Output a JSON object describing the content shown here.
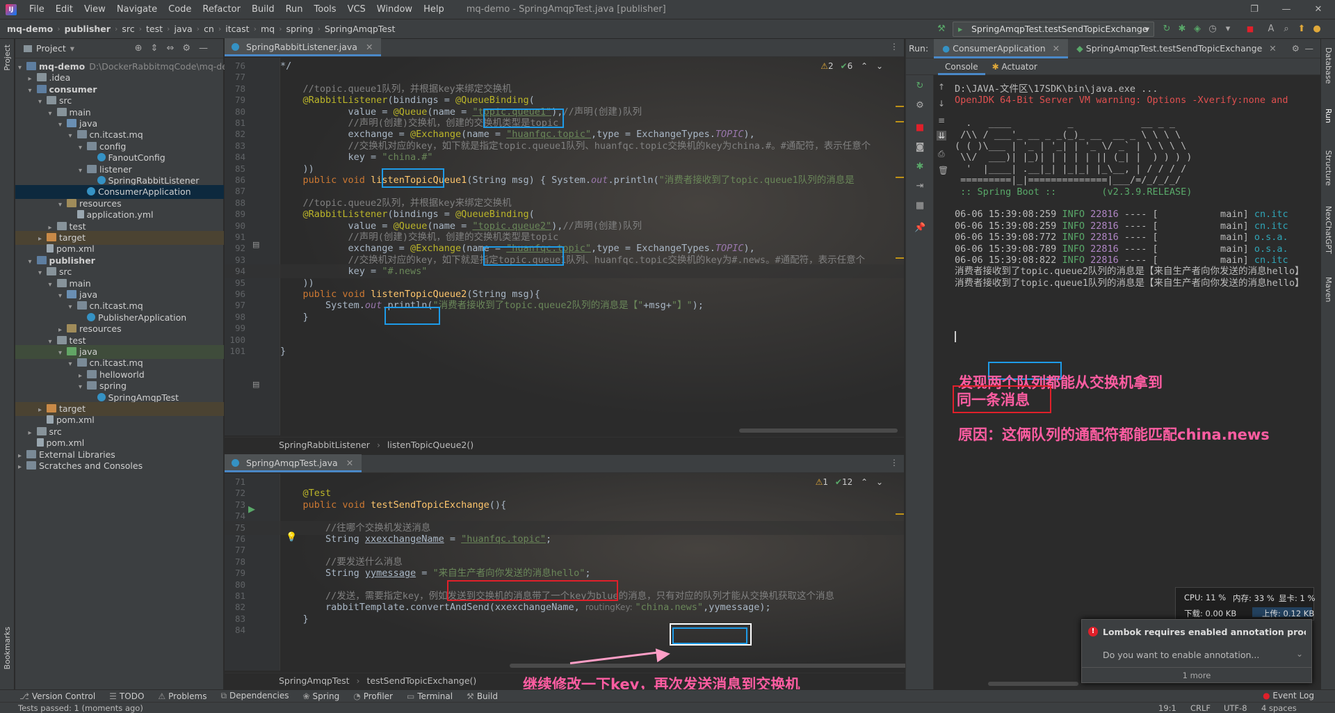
{
  "menubar": {
    "items": [
      "File",
      "Edit",
      "View",
      "Navigate",
      "Code",
      "Refactor",
      "Build",
      "Run",
      "Tools",
      "VCS",
      "Window",
      "Help"
    ],
    "window_title": "mq-demo - SpringAmqpTest.java [publisher]"
  },
  "navbar": {
    "crumbs": [
      "mq-demo",
      "publisher",
      "src",
      "test",
      "java",
      "cn",
      "itcast",
      "mq",
      "spring",
      "SpringAmqpTest"
    ],
    "run_config": "SpringAmqpTest.testSendTopicExchange"
  },
  "left_strip": {
    "project_label": "Project",
    "bookmarks_label": "Bookmarks"
  },
  "right_strip": {
    "labels": [
      "Database",
      "Run",
      "Structure",
      "NexChatGPT",
      "Maven"
    ]
  },
  "project": {
    "title": "Project",
    "tree": [
      {
        "label": "mq-demo",
        "path": "D:\\DockerRabbitmqCode\\mq-de",
        "depth": 0,
        "arrow": "▾",
        "icon": "module",
        "bold": true
      },
      {
        "label": ".idea",
        "depth": 1,
        "arrow": "▸",
        "icon": "folder"
      },
      {
        "label": "consumer",
        "depth": 1,
        "arrow": "▾",
        "icon": "module",
        "bold": true
      },
      {
        "label": "src",
        "depth": 2,
        "arrow": "▾",
        "icon": "folder"
      },
      {
        "label": "main",
        "depth": 3,
        "arrow": "▾",
        "icon": "folder"
      },
      {
        "label": "java",
        "depth": 4,
        "arrow": "▾",
        "icon": "folder-src"
      },
      {
        "label": "cn.itcast.mq",
        "depth": 5,
        "arrow": "▾",
        "icon": "pkg"
      },
      {
        "label": "config",
        "depth": 6,
        "arrow": "▾",
        "icon": "pkg"
      },
      {
        "label": "FanoutConfig",
        "depth": 7,
        "arrow": "",
        "icon": "cls"
      },
      {
        "label": "listener",
        "depth": 6,
        "arrow": "▾",
        "icon": "pkg"
      },
      {
        "label": "SpringRabbitListener",
        "depth": 7,
        "arrow": "",
        "icon": "cls"
      },
      {
        "label": "ConsumerApplication",
        "depth": 6,
        "arrow": "",
        "icon": "cls",
        "selected": true
      },
      {
        "label": "resources",
        "depth": 4,
        "arrow": "▾",
        "icon": "folder-res"
      },
      {
        "label": "application.yml",
        "depth": 5,
        "arrow": "",
        "icon": "file"
      },
      {
        "label": "test",
        "depth": 3,
        "arrow": "▸",
        "icon": "folder"
      },
      {
        "label": "target",
        "depth": 2,
        "arrow": "▸",
        "icon": "folder-target",
        "excluded": true
      },
      {
        "label": "pom.xml",
        "depth": 2,
        "arrow": "",
        "icon": "file"
      },
      {
        "label": "publisher",
        "depth": 1,
        "arrow": "▾",
        "icon": "module",
        "bold": true
      },
      {
        "label": "src",
        "depth": 2,
        "arrow": "▾",
        "icon": "folder"
      },
      {
        "label": "main",
        "depth": 3,
        "arrow": "▾",
        "icon": "folder"
      },
      {
        "label": "java",
        "depth": 4,
        "arrow": "▾",
        "icon": "folder-src"
      },
      {
        "label": "cn.itcast.mq",
        "depth": 5,
        "arrow": "▾",
        "icon": "pkg"
      },
      {
        "label": "PublisherApplication",
        "depth": 6,
        "arrow": "",
        "icon": "cls"
      },
      {
        "label": "resources",
        "depth": 4,
        "arrow": "▸",
        "icon": "folder-res"
      },
      {
        "label": "test",
        "depth": 3,
        "arrow": "▾",
        "icon": "folder"
      },
      {
        "label": "java",
        "depth": 4,
        "arrow": "▾",
        "icon": "folder-test",
        "testbg": true
      },
      {
        "label": "cn.itcast.mq",
        "depth": 5,
        "arrow": "▾",
        "icon": "pkg"
      },
      {
        "label": "helloworld",
        "depth": 6,
        "arrow": "▸",
        "icon": "pkg"
      },
      {
        "label": "spring",
        "depth": 6,
        "arrow": "▾",
        "icon": "pkg"
      },
      {
        "label": "SpringAmqpTest",
        "depth": 7,
        "arrow": "",
        "icon": "cls"
      },
      {
        "label": "target",
        "depth": 2,
        "arrow": "▸",
        "icon": "folder-target",
        "excluded": true
      },
      {
        "label": "pom.xml",
        "depth": 2,
        "arrow": "",
        "icon": "file"
      },
      {
        "label": "src",
        "depth": 1,
        "arrow": "▸",
        "icon": "folder"
      },
      {
        "label": "pom.xml",
        "depth": 1,
        "arrow": "",
        "icon": "file"
      },
      {
        "label": "External Libraries",
        "depth": 0,
        "arrow": "▸",
        "icon": "pkg"
      },
      {
        "label": "Scratches and Consoles",
        "depth": 0,
        "arrow": "▸",
        "icon": "pkg"
      }
    ]
  },
  "editor_top": {
    "tab": "SpringRabbitListener.java",
    "inspect": {
      "warnings": "2",
      "ok": "6"
    },
    "breadcrumb": [
      "SpringRabbitListener",
      "listenTopicQueue2()"
    ],
    "lines": [
      {
        "n": "76",
        "html": "*/",
        "cls": "cmt"
      },
      {
        "n": "77",
        "html": ""
      },
      {
        "n": "78",
        "html": "    <span class=\"cmt\">//topic.queue1队列，并根据key来绑定交换机</span>"
      },
      {
        "n": "79",
        "html": "    <span class=\"ann\">@RabbitListener</span>(bindings = <span class=\"ann\">@QueueBinding</span>("
      },
      {
        "n": "80",
        "html": "            value = <span class=\"ann\">@Queue</span>(name = <span class=\"str uline\">\"topic.queue1\"</span>),<span class=\"cmt\">//声明(创建)队列</span>"
      },
      {
        "n": "81",
        "html": "            <span class=\"cmt\">//声明(创建)交换机，创建的交换机类型是topic</span>"
      },
      {
        "n": "82",
        "html": "            exchange = <span class=\"ann\">@Exchange</span>(name = <span class=\"str uline\">\"huanfqc.topic\"</span>,type = ExchangeTypes.<span class=\"const\">TOPIC</span>),"
      },
      {
        "n": "83",
        "html": "            <span class=\"cmt\">//交换机对应的key，如下就是指定topic.queue1队列、huanfqc.topic交换机的key为china.#。#通配符，表示任意个</span>"
      },
      {
        "n": "84",
        "html": "            key = <span class=\"str\">\"china.#\"</span>"
      },
      {
        "n": "85",
        "html": "    ))"
      },
      {
        "n": "86",
        "html": "    <span class=\"kw\">public void</span> <span class=\"fn\">listenTopicQueue1</span>(String msg) { System.<span class=\"const\">out</span>.println(<span class=\"str\">\"消费者接收到了topic.queue1队列的消息是</span>"
      },
      {
        "n": "87",
        "html": ""
      },
      {
        "n": "88",
        "html": "    <span class=\"cmt\">//topic.queue2队列，并根据key来绑定交换机</span>"
      },
      {
        "n": "89",
        "html": "    <span class=\"ann\">@RabbitListener</span>(bindings = <span class=\"ann\">@QueueBinding</span>("
      },
      {
        "n": "90",
        "html": "            value = <span class=\"ann\">@Queue</span>(name = <span class=\"str uline\">\"topic.queue2\"</span>),<span class=\"cmt\">//声明(创建)队列</span>"
      },
      {
        "n": "91",
        "html": "            <span class=\"cmt\">//声明(创建)交换机，创建的交换机类型是topic</span>"
      },
      {
        "n": "92",
        "html": "            exchange = <span class=\"ann\">@Exchange</span>(name = <span class=\"str uline\">\"huanfqc.topic\"</span>,type = ExchangeTypes.<span class=\"const\">TOPIC</span>),"
      },
      {
        "n": "93",
        "html": "            <span class=\"cmt\">//交换机对应的key，如下就是指定topic.queue1队列、huanfqc.topic交换机的key为#.news。#通配符，表示任意个</span>"
      },
      {
        "n": "94",
        "html": "            key = <span class=\"str\">\"#.news\"</span>",
        "current": true
      },
      {
        "n": "95",
        "html": "    ))"
      },
      {
        "n": "96",
        "html": "    <span class=\"kw\">public void</span> <span class=\"fn\">listenTopicQueue2</span>(String msg){"
      },
      {
        "n": "97",
        "html": "        System.<span class=\"const\">out</span>.println(<span class=\"str\">\"消费者接收到了topic.queue2队列的消息是【\"</span>+msg+<span class=\"str\">\"】\"</span>);"
      },
      {
        "n": "98",
        "html": "    }"
      },
      {
        "n": "99",
        "html": ""
      },
      {
        "n": "100",
        "html": ""
      },
      {
        "n": "101",
        "html": "}"
      }
    ]
  },
  "editor_bottom": {
    "tab": "SpringAmqpTest.java",
    "inspect": {
      "warnings": "1",
      "ok": "12"
    },
    "breadcrumb": [
      "SpringAmqpTest",
      "testSendTopicExchange()"
    ],
    "lines": [
      {
        "n": "71",
        "html": ""
      },
      {
        "n": "72",
        "html": "    <span class=\"ann\">@Test</span>"
      },
      {
        "n": "73",
        "html": "    <span class=\"kw\">public void</span> <span class=\"fn\">testSendTopicExchange</span>(){"
      },
      {
        "n": "74",
        "html": ""
      },
      {
        "n": "75",
        "html": "        <span class=\"cmt\">//往哪个交换机发送消息</span>",
        "current": true
      },
      {
        "n": "76",
        "html": "        String <span class=\"uline\">xxexchangeName</span> = <span class=\"str uline\">\"huanfqc.topic\"</span>;"
      },
      {
        "n": "77",
        "html": ""
      },
      {
        "n": "78",
        "html": "        <span class=\"cmt\">//要发送什么消息</span>"
      },
      {
        "n": "79",
        "html": "        String <span class=\"uline\">yymessage</span> = <span class=\"str\">\"来自生产者向你发送的消息hello\"</span>;"
      },
      {
        "n": "80",
        "html": ""
      },
      {
        "n": "81",
        "html": "        <span class=\"cmt\">//发送，需要指定key，例如发送到交换机的消息带了一个key为blue的消息，只有对应的队列才能从交换机获取这个消息</span>"
      },
      {
        "n": "82",
        "html": "        rabbitTemplate.convertAndSend(xxexchangeName, <span class=\"hint\">routingKey: </span><span class=\"str\">\"china.news\"</span>,yymessage);"
      },
      {
        "n": "83",
        "html": "    }"
      },
      {
        "n": "84",
        "html": ""
      }
    ]
  },
  "run": {
    "label": "Run:",
    "tabs": [
      "ConsumerApplication",
      "SpringAmqpTest.testSendTopicExchange"
    ],
    "subtabs": [
      "Console",
      "Actuator"
    ],
    "console": [
      {
        "type": "plain",
        "text": "D:\\JAVA-文件区\\17SDK\\bin\\java.exe ..."
      },
      {
        "type": "warn",
        "text": "OpenJDK 64-Bit Server VM warning: Options -Xverify:none and"
      },
      {
        "type": "ascii",
        "text": ""
      },
      {
        "type": "ascii",
        "text": "  .   ____          _            __ _ _"
      },
      {
        "type": "ascii",
        "text": " /\\\\ / ___'_ __ _ _(_)_ __  __ _ \\ \\ \\ \\"
      },
      {
        "type": "ascii",
        "text": "( ( )\\___ | '_ | '_| | '_ \\/ _` | \\ \\ \\ \\"
      },
      {
        "type": "ascii",
        "text": " \\\\/  ___)| |_)| | | | | || (_| |  ) ) ) )"
      },
      {
        "type": "ascii",
        "text": "  '  |____| .__|_| |_|_| |_\\__, | / / / /"
      },
      {
        "type": "ascii",
        "text": " =========|_|==============|___/=/_/_/_/"
      },
      {
        "type": "boot",
        "text": " :: Spring Boot ::        (v2.3.9.RELEASE)"
      },
      {
        "type": "ascii",
        "text": ""
      },
      {
        "type": "log",
        "time": "06-06 15:39:08:259",
        "level": "INFO",
        "pid": "22816",
        "thread": "---- [           main]",
        "cls": "cn.itc"
      },
      {
        "type": "log",
        "time": "06-06 15:39:08:259",
        "level": "INFO",
        "pid": "22816",
        "thread": "---- [           main]",
        "cls": "cn.itc"
      },
      {
        "type": "log",
        "time": "06-06 15:39:08:772",
        "level": "INFO",
        "pid": "22816",
        "thread": "---- [           main]",
        "cls": "o.s.a."
      },
      {
        "type": "log",
        "time": "06-06 15:39:08:789",
        "level": "INFO",
        "pid": "22816",
        "thread": "---- [           main]",
        "cls": "o.s.a."
      },
      {
        "type": "log",
        "time": "06-06 15:39:08:822",
        "level": "INFO",
        "pid": "22816",
        "thread": "---- [           main]",
        "cls": "cn.itc"
      },
      {
        "type": "plain",
        "text": "消费者接收到了topic.queue2队列的消息是【来自生产者向你发送的消息hello】"
      },
      {
        "type": "plain",
        "text": "消费者接收到了topic.queue1队列的消息是【来自生产者向你发送的消息hello】"
      }
    ]
  },
  "annotations": {
    "note_both_queues_1": "发现两个队列都能从交换机拿到",
    "note_both_queues_2": "同一条消息",
    "note_reason": "原因：这俩队列的通配符都能匹配china.news",
    "note_modify_key": "继续修改一下key，再次发送消息到交换机"
  },
  "netmon": {
    "cpu": "CPU: 11 %",
    "mem": "内存: 33 %",
    "gpu": "显卡: 1 %",
    "down": "下载: 0.00 KB",
    "up": "上传: 0.12 KB"
  },
  "lombok": {
    "title": "Lombok requires enabled annotation process",
    "body": "Do you want to enable annotation...",
    "more": "1 more"
  },
  "tooltabs": [
    "Version Control",
    "TODO",
    "Problems",
    "Dependencies",
    "Spring",
    "Profiler",
    "Terminal",
    "Build"
  ],
  "event_log": "Event Log",
  "status": {
    "left": "Tests passed: 1 (moments ago)",
    "pos": "19:1",
    "eol": "CRLF",
    "enc": "UTF-8",
    "indent": "4 spaces"
  }
}
